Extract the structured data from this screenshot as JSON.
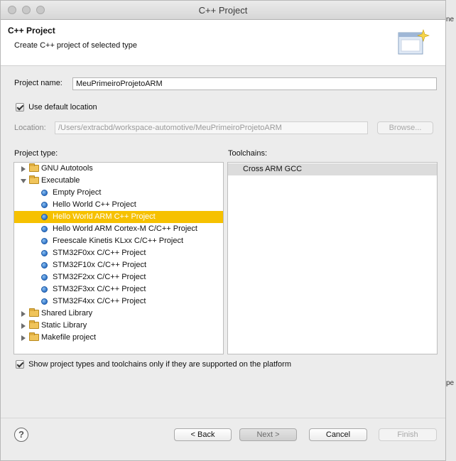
{
  "window": {
    "title": "C++ Project"
  },
  "header": {
    "title": "C++ Project",
    "subtitle": "Create C++ project of selected type"
  },
  "project_name": {
    "label": "Project name:",
    "value": "MeuPrimeiroProjetoARM"
  },
  "use_default_location": {
    "label": "Use default location",
    "checked": true
  },
  "location": {
    "label": "Location:",
    "value": "/Users/extracbd/workspace-automotive/MeuPrimeiroProjetoARM",
    "browse_label": "Browse..."
  },
  "project_type": {
    "label": "Project type:",
    "items": [
      {
        "label": "GNU Autotools",
        "kind": "folder",
        "expand": "collapsed"
      },
      {
        "label": "Executable",
        "kind": "folder",
        "expand": "expanded"
      },
      {
        "label": "Empty Project",
        "kind": "leaf"
      },
      {
        "label": "Hello World C++ Project",
        "kind": "leaf"
      },
      {
        "label": "Hello World ARM C++ Project",
        "kind": "leaf",
        "selected": true
      },
      {
        "label": "Hello World ARM Cortex-M C/C++ Project",
        "kind": "leaf"
      },
      {
        "label": "Freescale Kinetis KLxx C/C++ Project",
        "kind": "leaf"
      },
      {
        "label": "STM32F0xx C/C++ Project",
        "kind": "leaf"
      },
      {
        "label": "STM32F10x C/C++ Project",
        "kind": "leaf"
      },
      {
        "label": "STM32F2xx C/C++ Project",
        "kind": "leaf"
      },
      {
        "label": "STM32F3xx C/C++ Project",
        "kind": "leaf"
      },
      {
        "label": "STM32F4xx C/C++ Project",
        "kind": "leaf"
      },
      {
        "label": "Shared Library",
        "kind": "folder",
        "expand": "collapsed"
      },
      {
        "label": "Static Library",
        "kind": "folder",
        "expand": "collapsed"
      },
      {
        "label": "Makefile project",
        "kind": "folder",
        "expand": "collapsed"
      }
    ]
  },
  "toolchains": {
    "label": "Toolchains:",
    "items": [
      {
        "label": "Cross ARM GCC",
        "selected": true
      }
    ]
  },
  "show_supported": {
    "label": "Show project types and toolchains only if they are supported on the platform",
    "checked": true
  },
  "footer": {
    "help_glyph": "?",
    "back_label": "< Back",
    "next_label": "Next >",
    "cancel_label": "Cancel",
    "finish_label": "Finish"
  },
  "backdrop": {
    "fragment_top": "ne",
    "fragment_bottom": "pe"
  },
  "colors": {
    "selection": "#f6c100",
    "window_bg": "#ececec"
  }
}
